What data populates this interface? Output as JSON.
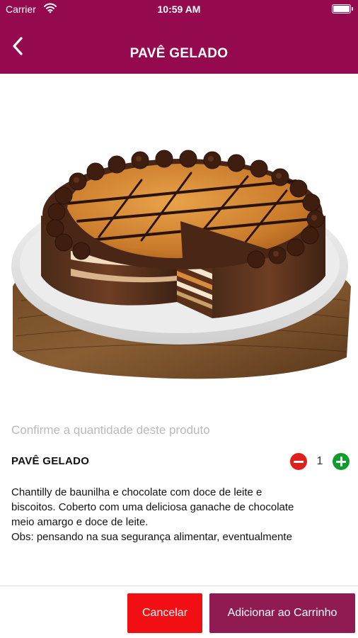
{
  "status_bar": {
    "carrier": "Carrier",
    "time": "10:59 AM",
    "wifi_icon": "wifi-icon",
    "battery_icon": "battery-icon"
  },
  "nav": {
    "title": "PAVÊ GELADO",
    "back_icon": "chevron-left-icon"
  },
  "product": {
    "image_icon": "cake-photo",
    "confirm_text": "Confirme a quantidade deste produto",
    "name": "PAVÊ GELADO",
    "quantity": "1",
    "description_lines": [
      "Chantilly de baunilha e chocolate com doce de leite e",
      "biscoitos. Coberto com uma deliciosa ganache de chocolate",
      "meio amargo e doce de leite.",
      "Obs: pensando na sua segurança alimentar, eventualmente"
    ]
  },
  "footer": {
    "cancel_label": "Cancelar",
    "add_label": "Adicionar ao Carrinho"
  },
  "colors": {
    "brand": "#950a4e",
    "cancel": "#f10f13",
    "add": "#8f1b52",
    "minus": "#e0201c",
    "plus": "#119b2c",
    "placeholder_gray": "#b9b9b9"
  }
}
